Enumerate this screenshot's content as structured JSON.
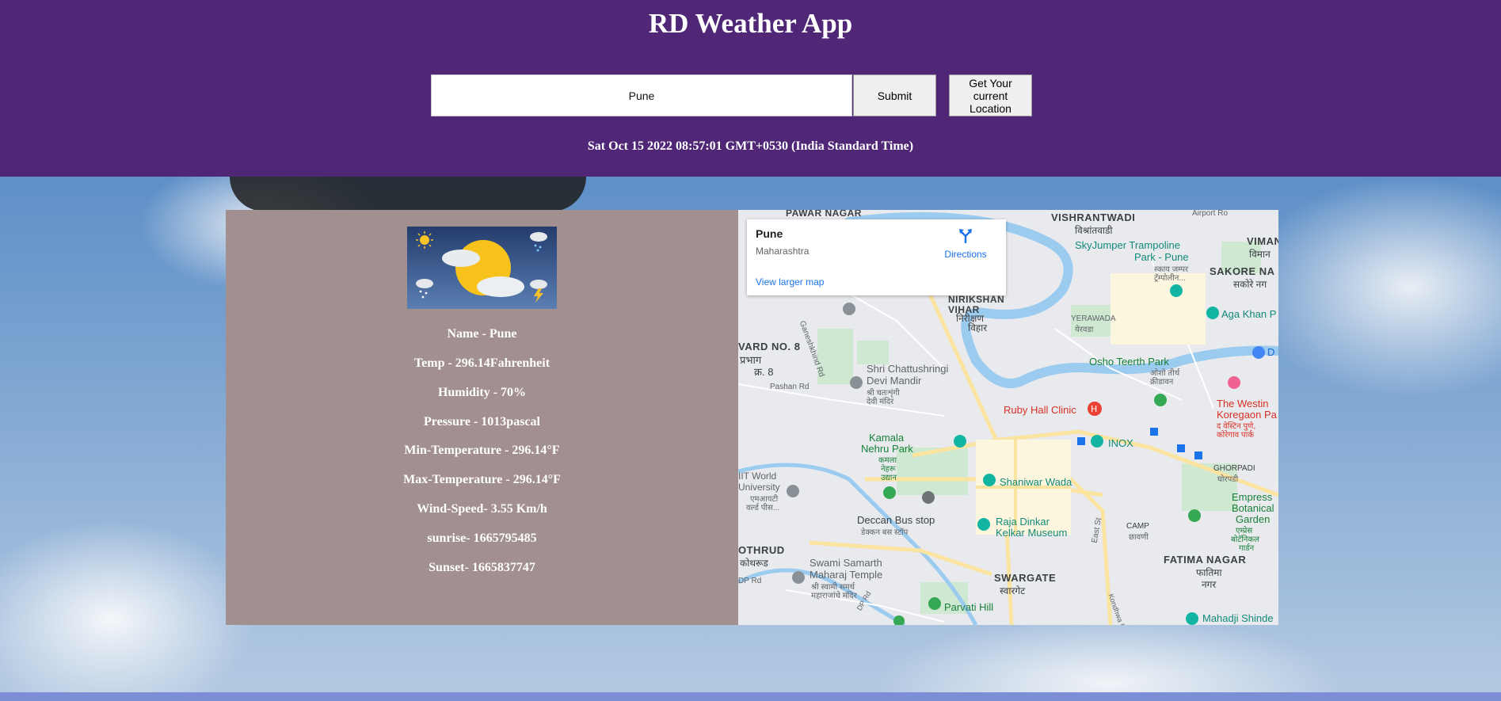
{
  "app": {
    "title": "RD Weather App"
  },
  "search": {
    "value": "Pune",
    "submit_label": "Submit",
    "location_label": "Get Your current Location"
  },
  "datetime": "Sat Oct 15 2022 08:57:01 GMT+0530 (India Standard Time)",
  "weather": {
    "lines": [
      "Name - Pune",
      "Temp - 296.14Fahrenheit",
      "Humidity - 70%",
      "Pressure - 1013pascal",
      "Min-Temperature - 296.14°F",
      "Max-Temperature - 296.14°F",
      "Wind-Speed- 3.55 Km/h",
      "sunrise- 1665795485",
      "Sunset- 1665837747"
    ]
  },
  "map": {
    "card": {
      "place": "Pune",
      "region": "Maharashtra",
      "directions": "Directions",
      "larger_map": "View larger map"
    },
    "labels": {
      "pawar_nagar": "PAWAR NAGAR",
      "vishrantwadi": "VISHRANTWADI",
      "vishrantwadi_mr": "विश्रांतवाडी",
      "airport_rd": "Airport Ro",
      "skyjumper": "SkyJumper Trampoline",
      "skyjumper2": "Park - Pune",
      "skyjumper_mr": "स्काय जम्पर",
      "skyjumper_mr2": "ट्रॅम्पोलीन...",
      "viman": "VIMAN N",
      "viman_mr": "विमान",
      "sakore": "SAKORE NA",
      "sakore_mr": "सकोरे नग",
      "nirikshan": "NIRIKSHAN",
      "vihar": "VIHAR",
      "nirikshan_mr": "निरीक्षण",
      "vihar_mr": "विहार",
      "yerawada": "YERAWADA",
      "yerawada_mr": "येरवडा",
      "aga_khan": "Aga Khan P",
      "ward": "VARD NO. 8",
      "ward_mr": "प्रभाग",
      "ward_mr2": "क्र. 8",
      "osho": "Osho Teerth Park",
      "osho_mr": "ओशो तीर्थ",
      "osho_mr2": "क्रीडावन",
      "shri": "Shri Chattushringi",
      "devi": "Devi Mandir",
      "shri_mr": "श्री चतःशृंगी",
      "devi_mr": "देवी मंदिर",
      "pashan": "Pashan Rd",
      "ganeshkhind": "Ganeshkhind Rd",
      "westin": "The Westin",
      "westin2": "Koregaon Pa",
      "westin_mr": "द वेस्टिन पुणे,",
      "westin_mr2": "कोरेगाव पार्क",
      "ruby": "Ruby Hall Clinic",
      "kamala": "Kamala",
      "nehru": "Nehru Park",
      "kamala_mr": "कमला",
      "nehru_mr": "नेहरू",
      "udyan_mr": "उद्यान",
      "inox": "INOX",
      "ghorpadi": "GHORPADI",
      "ghorpadi_mr": "घोरपडी",
      "mit": "IIT World",
      "mit2": "University",
      "mit_mr": "एमआयटी",
      "mit_mr2": "वर्ल्ड पीस...",
      "shaniwar": "Shaniwar Wada",
      "emp": "Empress",
      "emp2": "Botanical",
      "emp3": "Garden",
      "emp_mr": "एम्प्रेस",
      "emp_mr2": "बोटॅनिकल",
      "emp_mr3": "गार्डन",
      "deccan": "Deccan Bus stop",
      "deccan_mr": "डेक्कन बस स्टॉप",
      "raja": "Raja Dinkar",
      "kelkar": "Kelkar Museum",
      "camp": "CAMP",
      "camp_mr": "छावणी",
      "kothrud": "OTHRUD",
      "kothrud_mr": "कोथरूड",
      "dp_rd": "DP Rd",
      "swami": "Swami Samarth",
      "maharaj": "Maharaj Temple",
      "swami_mr": "श्री स्वामी समर्थ",
      "swami_mr2": "महाराजांचे मंदिर",
      "fatima": "FATIMA NAGAR",
      "fatima_mr": "फातिमा",
      "fatima_mr2": "नगर",
      "swargate": "SWARGATE",
      "swargate_mr": "स्वारगेट",
      "parvati": "Parvati Hill",
      "mahadji": "Mahadji Shinde",
      "east_st": "East St",
      "kondhwa": "Kondhwa Rd",
      "dp": "DP Rd",
      "d_label": "D"
    }
  },
  "colors": {
    "header": "#4f2776",
    "card": "#a29090",
    "accent": "#1a73e8"
  }
}
